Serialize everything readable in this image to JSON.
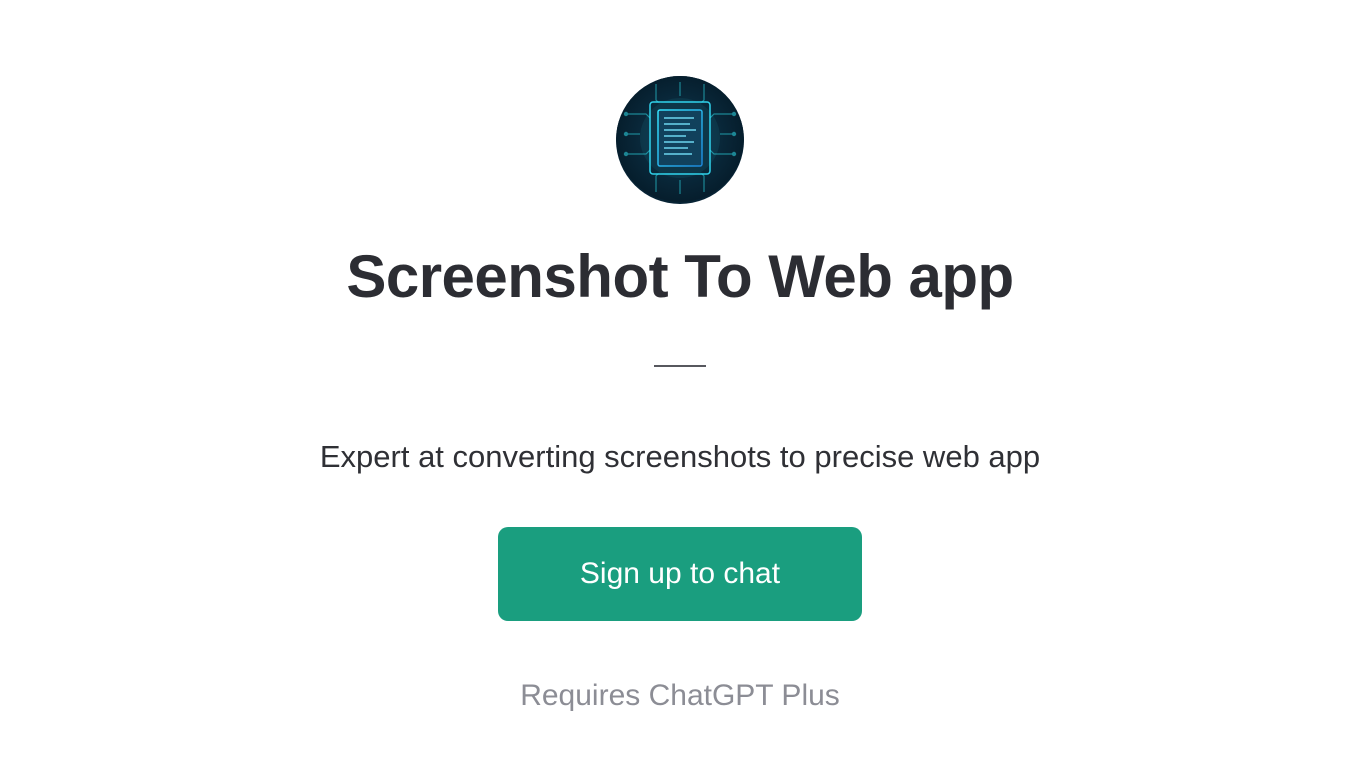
{
  "app": {
    "title": "Screenshot To Web app",
    "subtitle": "Expert at converting screenshots to precise web app",
    "cta_label": "Sign up to chat",
    "requirement": "Requires ChatGPT Plus",
    "avatar_alt": "circuit-document-icon",
    "colors": {
      "accent": "#1a9e7f",
      "title": "#2c2d33",
      "muted": "#8c8d95"
    }
  }
}
